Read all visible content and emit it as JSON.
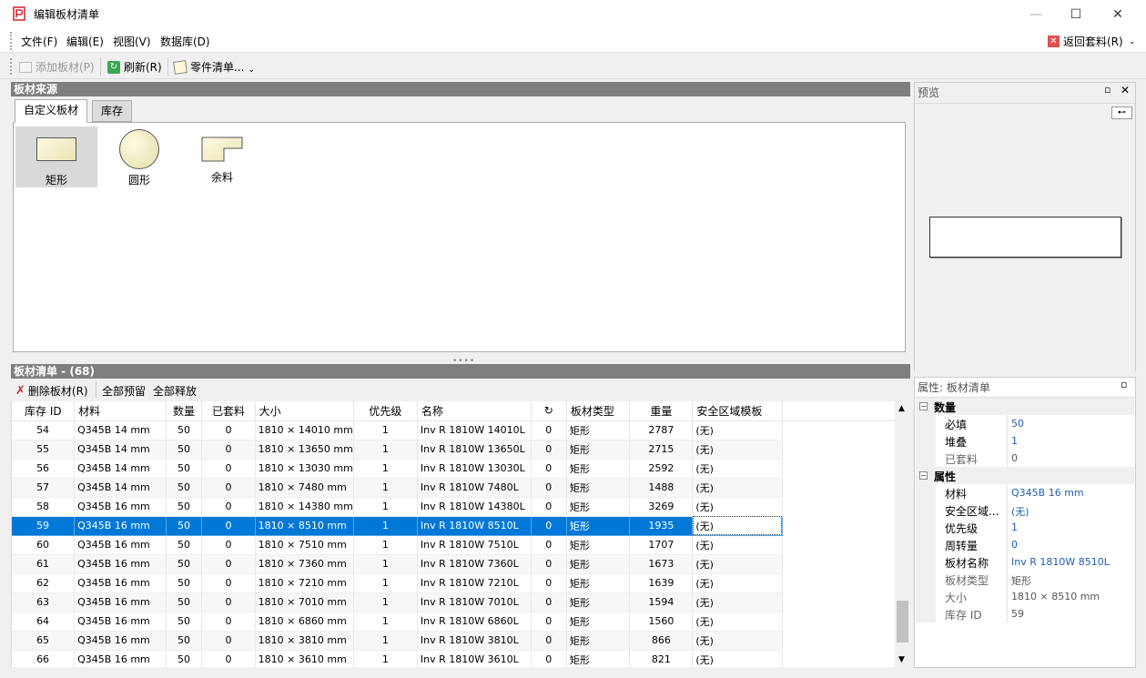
{
  "window": {
    "title": "编辑板材清单",
    "minimize": "—",
    "maximize": "☐",
    "close": "✕"
  },
  "menu": {
    "file": "文件(F)",
    "edit": "编辑(E)",
    "view": "视图(V)",
    "database": "数据库(D)",
    "back": "返回套料(R)"
  },
  "toolbar": {
    "add_sheet": "添加板材(P)",
    "refresh": "刷新(R)",
    "parts_list": "零件清单..."
  },
  "source_panel": {
    "title": "板材来源",
    "tabs": [
      "自定义板材",
      "库存"
    ],
    "shapes": [
      "矩形",
      "圆形",
      "余料"
    ]
  },
  "list_panel": {
    "title": "板材清单 - (68)",
    "delete": "删除板材(R)",
    "reserve_all": "全部预留",
    "release_all": "全部释放",
    "columns": [
      "库存 ID",
      "材料",
      "数量",
      "已套料",
      "大小",
      "优先级",
      "名称",
      "↻",
      "板材类型",
      "重量",
      "安全区域模板"
    ],
    "rows": [
      [
        "54",
        "Q345B 14 mm",
        "50",
        "0",
        "1810 × 14010 mm",
        "1",
        "Inv R 1810W 14010L",
        "0",
        "矩形",
        "2787",
        "(无)"
      ],
      [
        "55",
        "Q345B 14 mm",
        "50",
        "0",
        "1810 × 13650 mm",
        "1",
        "Inv R 1810W 13650L",
        "0",
        "矩形",
        "2715",
        "(无)"
      ],
      [
        "56",
        "Q345B 14 mm",
        "50",
        "0",
        "1810 × 13030 mm",
        "1",
        "Inv R 1810W 13030L",
        "0",
        "矩形",
        "2592",
        "(无)"
      ],
      [
        "57",
        "Q345B 14 mm",
        "50",
        "0",
        "1810 × 7480 mm",
        "1",
        "Inv R 1810W 7480L",
        "0",
        "矩形",
        "1488",
        "(无)"
      ],
      [
        "58",
        "Q345B 16 mm",
        "50",
        "0",
        "1810 × 14380 mm",
        "1",
        "Inv R 1810W 14380L",
        "0",
        "矩形",
        "3269",
        "(无)"
      ],
      [
        "59",
        "Q345B 16 mm",
        "50",
        "0",
        "1810 × 8510 mm",
        "1",
        "Inv R 1810W 8510L",
        "0",
        "矩形",
        "1935",
        "(无)"
      ],
      [
        "60",
        "Q345B 16 mm",
        "50",
        "0",
        "1810 × 7510 mm",
        "1",
        "Inv R 1810W 7510L",
        "0",
        "矩形",
        "1707",
        "(无)"
      ],
      [
        "61",
        "Q345B 16 mm",
        "50",
        "0",
        "1810 × 7360 mm",
        "1",
        "Inv R 1810W 7360L",
        "0",
        "矩形",
        "1673",
        "(无)"
      ],
      [
        "62",
        "Q345B 16 mm",
        "50",
        "0",
        "1810 × 7210 mm",
        "1",
        "Inv R 1810W 7210L",
        "0",
        "矩形",
        "1639",
        "(无)"
      ],
      [
        "63",
        "Q345B 16 mm",
        "50",
        "0",
        "1810 × 7010 mm",
        "1",
        "Inv R 1810W 7010L",
        "0",
        "矩形",
        "1594",
        "(无)"
      ],
      [
        "64",
        "Q345B 16 mm",
        "50",
        "0",
        "1810 × 6860 mm",
        "1",
        "Inv R 1810W 6860L",
        "0",
        "矩形",
        "1560",
        "(无)"
      ],
      [
        "65",
        "Q345B 16 mm",
        "50",
        "0",
        "1810 × 3810 mm",
        "1",
        "Inv R 1810W 3810L",
        "0",
        "矩形",
        "866",
        "(无)"
      ],
      [
        "66",
        "Q345B 16 mm",
        "50",
        "0",
        "1810 × 3610 mm",
        "1",
        "Inv R 1810W 3610L",
        "0",
        "矩形",
        "821",
        "(无)"
      ]
    ],
    "selected_row": 5
  },
  "preview": {
    "title": "预览"
  },
  "properties": {
    "title": "属性: 板材清单",
    "cat_quantity": "数量",
    "cat_props": "属性",
    "items": [
      {
        "name": "必填",
        "value": "50"
      },
      {
        "name": "堆叠",
        "value": "1"
      },
      {
        "name": "已套料",
        "value": "0"
      },
      {
        "name": "材料",
        "value": "Q345B 16 mm"
      },
      {
        "name": "安全区域...",
        "value": "(无)"
      },
      {
        "name": "优先级",
        "value": "1"
      },
      {
        "name": "周转量",
        "value": "0"
      },
      {
        "name": "板材名称",
        "value": "Inv R 1810W 8510L"
      },
      {
        "name": "板材类型",
        "value": "矩形"
      },
      {
        "name": "大小",
        "value": "1810 × 8510 mm"
      },
      {
        "name": "库存 ID",
        "value": "59"
      }
    ]
  }
}
